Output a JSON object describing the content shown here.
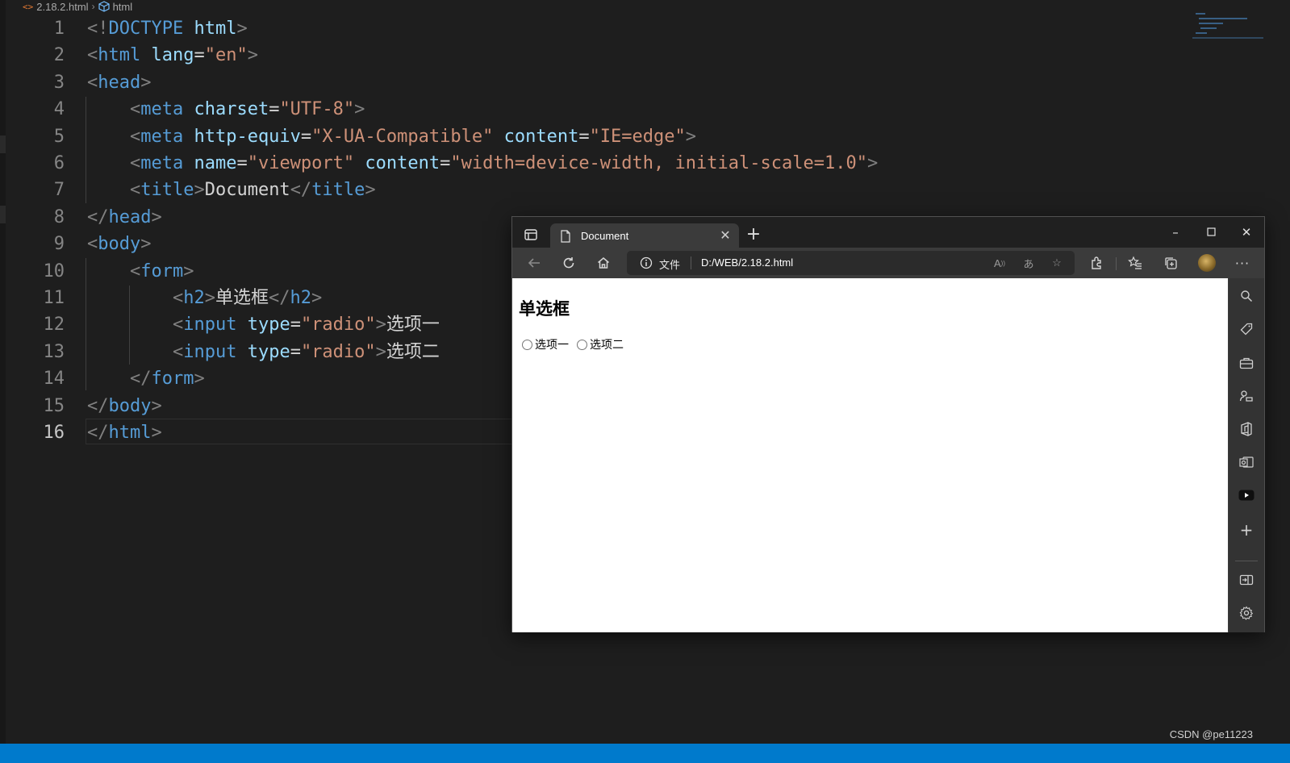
{
  "breadcrumb": {
    "file": "2.18.2.html",
    "symbol": "html"
  },
  "editor": {
    "active_line": 16,
    "lines": [
      {
        "n": "1",
        "t": [
          [
            "br",
            "<!"
          ],
          [
            "tag",
            "DOCTYPE "
          ],
          [
            "attr",
            "html"
          ],
          [
            "br",
            ">"
          ]
        ]
      },
      {
        "n": "2",
        "t": [
          [
            "br",
            "<"
          ],
          [
            "tag",
            "html "
          ],
          [
            "attr",
            "lang"
          ],
          [
            "txt",
            "="
          ],
          [
            "str",
            "\"en\""
          ],
          [
            "br",
            ">"
          ]
        ]
      },
      {
        "n": "3",
        "t": [
          [
            "br",
            "<"
          ],
          [
            "tag",
            "head"
          ],
          [
            "br",
            ">"
          ]
        ]
      },
      {
        "n": "4",
        "t": [
          [
            "txt",
            "    "
          ],
          [
            "br",
            "<"
          ],
          [
            "tag",
            "meta "
          ],
          [
            "attr",
            "charset"
          ],
          [
            "txt",
            "="
          ],
          [
            "str",
            "\"UTF-8\""
          ],
          [
            "br",
            ">"
          ]
        ]
      },
      {
        "n": "5",
        "t": [
          [
            "txt",
            "    "
          ],
          [
            "br",
            "<"
          ],
          [
            "tag",
            "meta "
          ],
          [
            "attr",
            "http-equiv"
          ],
          [
            "txt",
            "="
          ],
          [
            "str",
            "\"X-UA-Compatible\" "
          ],
          [
            "attr",
            "content"
          ],
          [
            "txt",
            "="
          ],
          [
            "str",
            "\"IE=edge\""
          ],
          [
            "br",
            ">"
          ]
        ]
      },
      {
        "n": "6",
        "t": [
          [
            "txt",
            "    "
          ],
          [
            "br",
            "<"
          ],
          [
            "tag",
            "meta "
          ],
          [
            "attr",
            "name"
          ],
          [
            "txt",
            "="
          ],
          [
            "str",
            "\"viewport\" "
          ],
          [
            "attr",
            "content"
          ],
          [
            "txt",
            "="
          ],
          [
            "str",
            "\"width=device-width, initial-scale=1.0\""
          ],
          [
            "br",
            ">"
          ]
        ]
      },
      {
        "n": "7",
        "t": [
          [
            "txt",
            "    "
          ],
          [
            "br",
            "<"
          ],
          [
            "tag",
            "title"
          ],
          [
            "br",
            ">"
          ],
          [
            "txt",
            "Document"
          ],
          [
            "br",
            "</"
          ],
          [
            "tag",
            "title"
          ],
          [
            "br",
            ">"
          ]
        ]
      },
      {
        "n": "8",
        "t": [
          [
            "br",
            "</"
          ],
          [
            "tag",
            "head"
          ],
          [
            "br",
            ">"
          ]
        ]
      },
      {
        "n": "9",
        "t": [
          [
            "br",
            "<"
          ],
          [
            "tag",
            "body"
          ],
          [
            "br",
            ">"
          ]
        ]
      },
      {
        "n": "10",
        "t": [
          [
            "txt",
            "    "
          ],
          [
            "br",
            "<"
          ],
          [
            "tag",
            "form"
          ],
          [
            "br",
            ">"
          ]
        ]
      },
      {
        "n": "11",
        "t": [
          [
            "txt",
            "        "
          ],
          [
            "br",
            "<"
          ],
          [
            "tag",
            "h2"
          ],
          [
            "br",
            ">"
          ],
          [
            "txt",
            "单选框"
          ],
          [
            "br",
            "</"
          ],
          [
            "tag",
            "h2"
          ],
          [
            "br",
            ">"
          ]
        ]
      },
      {
        "n": "12",
        "t": [
          [
            "txt",
            "        "
          ],
          [
            "br",
            "<"
          ],
          [
            "tag",
            "input "
          ],
          [
            "attr",
            "type"
          ],
          [
            "txt",
            "="
          ],
          [
            "str",
            "\"radio\""
          ],
          [
            "br",
            ">"
          ],
          [
            "txt",
            "选项一"
          ]
        ]
      },
      {
        "n": "13",
        "t": [
          [
            "txt",
            "        "
          ],
          [
            "br",
            "<"
          ],
          [
            "tag",
            "input "
          ],
          [
            "attr",
            "type"
          ],
          [
            "txt",
            "="
          ],
          [
            "str",
            "\"radio\""
          ],
          [
            "br",
            ">"
          ],
          [
            "txt",
            "选项二"
          ]
        ]
      },
      {
        "n": "14",
        "t": [
          [
            "txt",
            "    "
          ],
          [
            "br",
            "</"
          ],
          [
            "tag",
            "form"
          ],
          [
            "br",
            ">"
          ]
        ]
      },
      {
        "n": "15",
        "t": [
          [
            "br",
            "</"
          ],
          [
            "tag",
            "body"
          ],
          [
            "br",
            ">"
          ]
        ]
      },
      {
        "n": "16",
        "t": [
          [
            "br",
            "</"
          ],
          [
            "tag",
            "html"
          ],
          [
            "br",
            ">"
          ]
        ]
      }
    ]
  },
  "browser": {
    "tab_title": "Document",
    "address_label": "文件",
    "url": "D:/WEB/2.18.2.html",
    "page": {
      "heading": "单选框",
      "options": [
        "选项一",
        "选项二"
      ]
    }
  },
  "watermark": "CSDN @pe11223",
  "icons": {
    "titlebar": [
      "tab-actions-icon",
      "page-icon",
      "close-icon",
      "plus-icon",
      "minimize-icon",
      "maximize-icon",
      "close-window-icon"
    ],
    "toolbar": [
      "back-arrow-icon",
      "refresh-icon",
      "home-icon",
      "info-icon",
      "read-aloud-icon",
      "translate-icon",
      "add-favorite-icon",
      "extensions-icon",
      "favorites-icon",
      "collections-icon",
      "more-icon"
    ],
    "sidebar": [
      "search-icon",
      "tag-icon",
      "briefcase-icon",
      "games-icon",
      "office-icon",
      "outlook-icon",
      "youtube-icon",
      "plus-icon",
      "hide-sidebar-icon",
      "settings-icon"
    ]
  }
}
